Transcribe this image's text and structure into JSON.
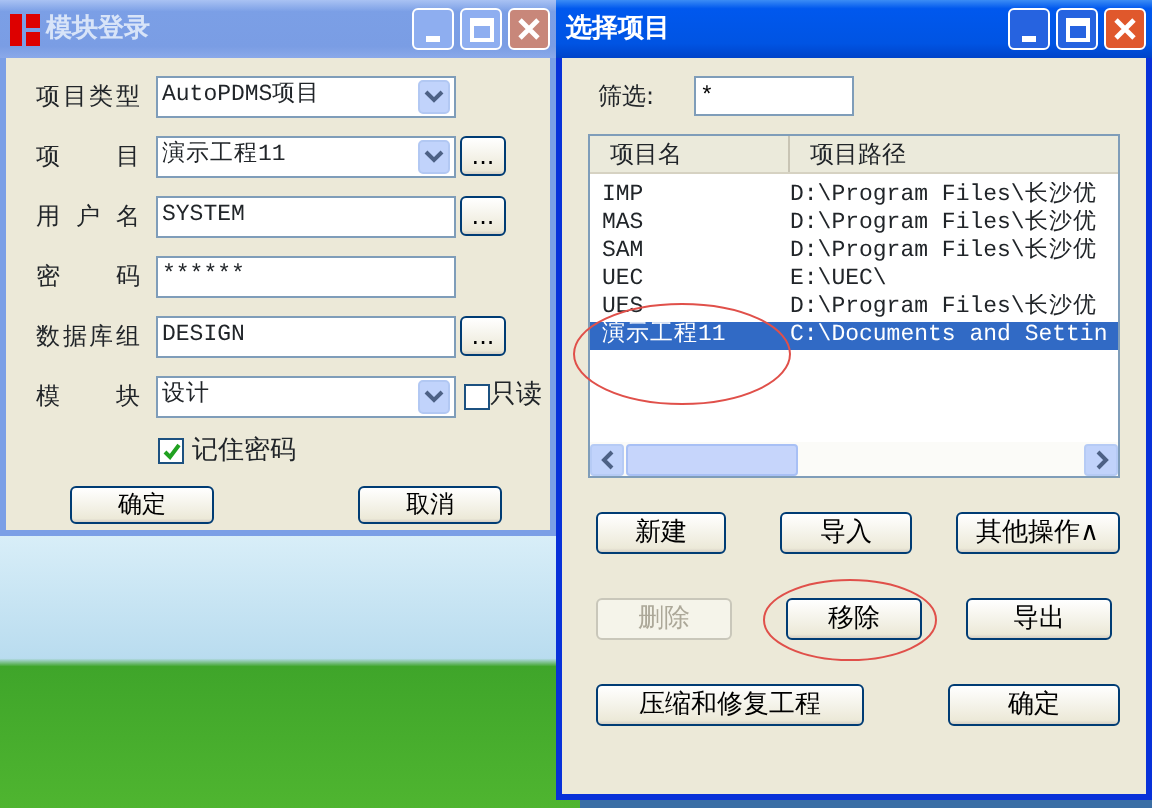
{
  "login_window": {
    "title": "模块登录",
    "active": false,
    "fields": [
      {
        "label": "项目类型",
        "kind": "select",
        "value": "AutoPDMS项目"
      },
      {
        "label": "项目",
        "kind": "select",
        "value": "演示工程11",
        "browse": "..."
      },
      {
        "label": "用户名",
        "kind": "text",
        "value": "SYSTEM",
        "browse": "..."
      },
      {
        "label": "密码",
        "kind": "text",
        "value": "******"
      },
      {
        "label": "数据库组",
        "kind": "text",
        "value": "DESIGN",
        "browse": "..."
      },
      {
        "label": "模块",
        "kind": "select",
        "value": "设计",
        "checkbox": {
          "label": "只读",
          "checked": false
        }
      }
    ],
    "remember": {
      "label": "记住密码",
      "checked": true
    },
    "buttons": [
      "确定",
      "取消"
    ]
  },
  "project_window": {
    "title": "选择项目",
    "active": true,
    "filter": {
      "label": "筛选:",
      "value": "*"
    },
    "columns": [
      "项目名",
      "项目路径"
    ],
    "rows": [
      {
        "name": "IMP",
        "path": "D:\\Program Files\\长沙优",
        "selected": false
      },
      {
        "name": "MAS",
        "path": "D:\\Program Files\\长沙优",
        "selected": false
      },
      {
        "name": "SAM",
        "path": "D:\\Program Files\\长沙优",
        "selected": false
      },
      {
        "name": "UEC",
        "path": "E:\\UEC\\",
        "selected": false
      },
      {
        "name": "UES",
        "path": "D:\\Program Files\\长沙优",
        "selected": false
      },
      {
        "name": "演示工程11",
        "path": "C:\\Documents and Settin",
        "selected": true
      }
    ],
    "button_rows": [
      [
        {
          "label": "新建",
          "disabled": false
        },
        {
          "label": "导入",
          "disabled": false
        },
        {
          "label": "其他操作∧",
          "disabled": false
        }
      ],
      [
        {
          "label": "删除",
          "disabled": true
        },
        {
          "label": "移除",
          "disabled": false
        },
        {
          "label": "导出",
          "disabled": false
        }
      ],
      [
        {
          "label": "压缩和修复工程",
          "disabled": false
        },
        {
          "label": "确定",
          "disabled": false
        }
      ]
    ]
  }
}
